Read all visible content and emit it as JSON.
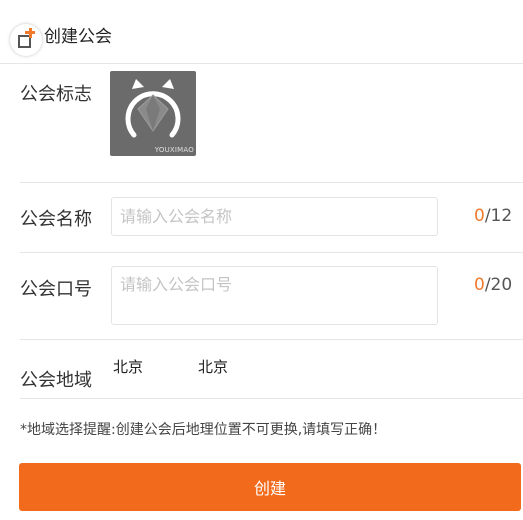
{
  "header": {
    "title": "创建公会",
    "back_icon": "add-square-icon"
  },
  "form": {
    "logo": {
      "label": "公会标志",
      "image_text": "YOUXIMAO"
    },
    "name": {
      "label": "公会名称",
      "placeholder": "请输入公会名称",
      "count_current": "0",
      "count_max": "/12"
    },
    "slogan": {
      "label": "公会口号",
      "placeholder": "请输入公会口号",
      "count_current": "0",
      "count_max": "/20"
    },
    "region": {
      "label": "公会地域",
      "province": "北京",
      "city": "北京"
    }
  },
  "notice": "*地域选择提醒:创建公会后地理位置不可更换,请填写正确！",
  "create_button": "创建",
  "colors": {
    "accent": "#f26b1d",
    "counter_current": "#f07a2b"
  }
}
